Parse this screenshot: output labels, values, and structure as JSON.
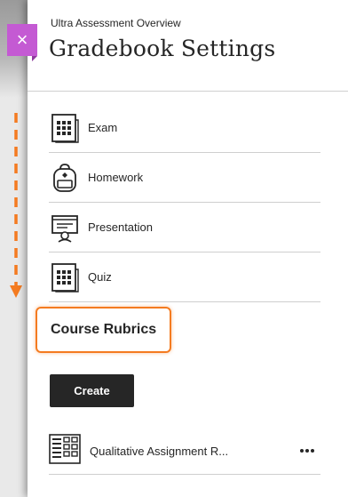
{
  "header": {
    "breadcrumb": "Ultra Assessment Overview",
    "title": "Gradebook Settings",
    "close_symbol": "×"
  },
  "categories": [
    {
      "label": "Exam",
      "icon": "exam-icon"
    },
    {
      "label": "Homework",
      "icon": "backpack-icon"
    },
    {
      "label": "Presentation",
      "icon": "presentation-icon"
    },
    {
      "label": "Quiz",
      "icon": "quiz-icon"
    }
  ],
  "rubrics": {
    "heading": "Course Rubrics",
    "create_label": "Create",
    "items": [
      {
        "label": "Qualitative Assignment R...",
        "icon": "rubric-icon"
      }
    ]
  },
  "colors": {
    "accent": "#c45ad3",
    "highlight": "#f47b20",
    "button": "#262626"
  }
}
